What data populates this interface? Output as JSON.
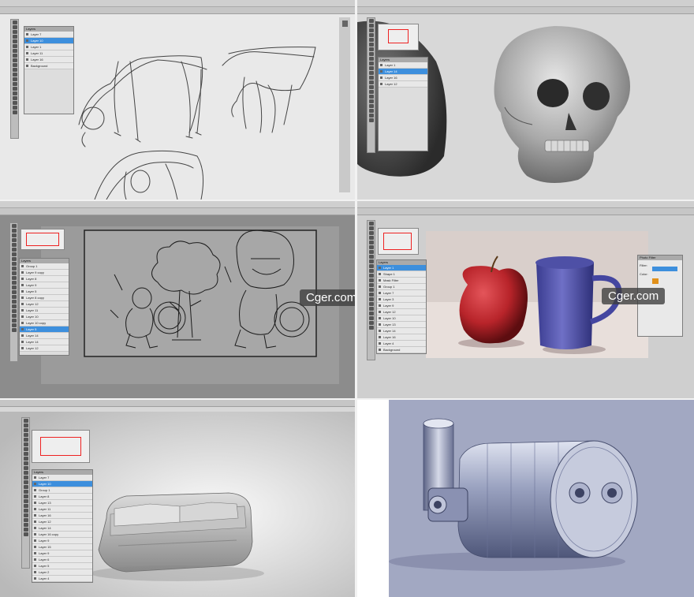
{
  "menu": [
    "File",
    "Edit",
    "Image",
    "Layer",
    "Select",
    "Filter",
    "View",
    "Window",
    "Help"
  ],
  "panel_title": "Layers",
  "blend_mode": "Normal",
  "opacity_label": "Opacity:",
  "opacity_value": "100%",
  "fill_label": "Fill:",
  "fill_value": "100%",
  "options": {
    "auto_select": "Auto-Select:",
    "layer_choice": "Layer",
    "show_transform": "Show Transform Controls"
  },
  "tile1": {
    "layers": [
      "Layer 7",
      "Layer 10",
      "Layer 1",
      "Layer 11",
      "Layer 16",
      "Background"
    ],
    "selected": 1
  },
  "tile2": {
    "layers": [
      "Layer 1",
      "Layer 14",
      "Layer 16",
      "Layer 12"
    ],
    "selected": 1
  },
  "tile3": {
    "layers": [
      "Group 1",
      "Layer 9 copy",
      "Layer 8",
      "Layer 9",
      "Layer 5",
      "Layer 8 copy",
      "Layer 12",
      "Layer 11",
      "Layer 10",
      "Layer 10 copy",
      "Layer 5",
      "Layer 14",
      "Layer 14",
      "Layer 12"
    ],
    "selected": 10
  },
  "tile4": {
    "layers": [
      "Layer 1",
      "Shape 1",
      "Mask Filter",
      "Group 1",
      "Layer 7",
      "Layer 3",
      "Layer 9",
      "Layer 12",
      "Layer 10",
      "Layer 13",
      "Layer 14",
      "Layer 16",
      "Layer 4",
      "Background"
    ],
    "selected": 0,
    "dialog_title": "Photo Filter",
    "dialog_filter_label": "Filter:",
    "dialog_color_label": "Color:"
  },
  "tile5": {
    "layers": [
      "Layer 7",
      "Layer 10",
      "Group 1",
      "Layer 8",
      "Layer 13",
      "Layer 11",
      "Layer 16",
      "Layer 12",
      "Layer 14",
      "Layer 16 copy",
      "Layer 9",
      "Layer 15",
      "Layer 9",
      "Layer 6",
      "Layer 5",
      "Layer 2",
      "Layer 4"
    ],
    "selected": 1
  },
  "watermark": "Cger.com",
  "colors": {
    "selected_layer": "#3d8fdd",
    "apple": "#b8242a",
    "mug": "#5a5bb0",
    "machine_bg": "#a2a8c2"
  }
}
